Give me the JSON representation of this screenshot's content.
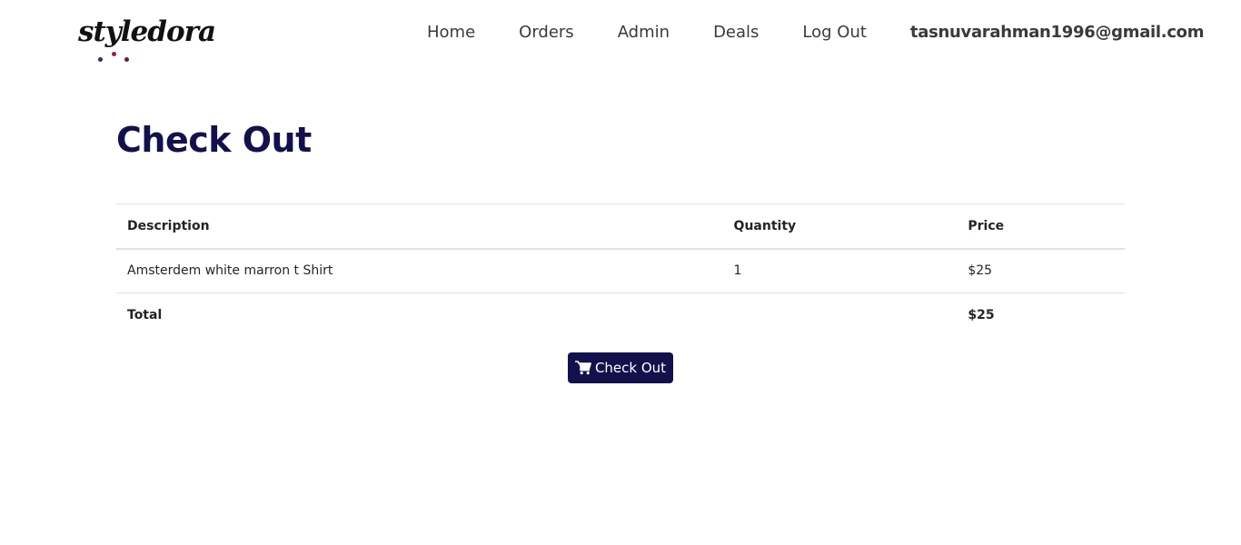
{
  "brand": {
    "logo_text": "styledora",
    "dot_colors": [
      "#2b2b6e",
      "#a0184a",
      "#6b1848"
    ]
  },
  "nav": {
    "links": [
      {
        "label": "Home"
      },
      {
        "label": "Orders"
      },
      {
        "label": "Admin"
      },
      {
        "label": "Deals"
      },
      {
        "label": "Log Out"
      }
    ],
    "user_email": "tasnuvarahman1996@gmail.com"
  },
  "page": {
    "title": "Check Out"
  },
  "table": {
    "headers": {
      "description": "Description",
      "quantity": "Quantity",
      "price": "Price"
    },
    "items": [
      {
        "description": "Amsterdem white marron t Shirt",
        "quantity": "1",
        "price": "$25"
      }
    ],
    "total": {
      "label": "Total",
      "price": "$25"
    }
  },
  "actions": {
    "checkout_label": "Check Out",
    "checkout_icon": "shopping-cart-icon"
  },
  "colors": {
    "primary": "#13114b",
    "border": "#dee2e6"
  }
}
